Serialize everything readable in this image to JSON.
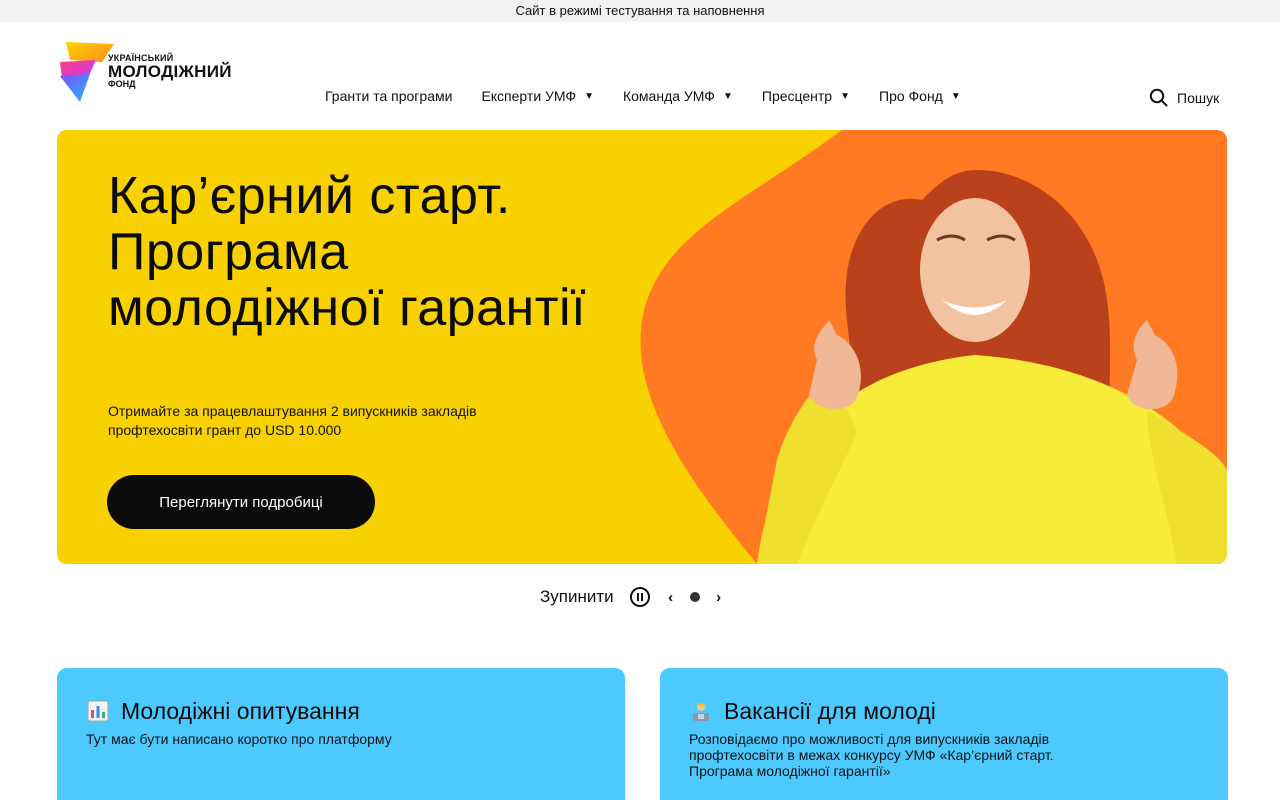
{
  "banner": {
    "text": "Сайт в режимі тестування та наповнення"
  },
  "logo": {
    "line1": "УКРАЇНСЬКИЙ",
    "line2": "МОЛОДІЖНИЙ",
    "line3": "ФОНД"
  },
  "nav": {
    "items": [
      {
        "label": "Гранти та програми",
        "dropdown": false
      },
      {
        "label": "Експерти УМФ",
        "dropdown": true
      },
      {
        "label": "Команда УМФ",
        "dropdown": true
      },
      {
        "label": "Пресцентр",
        "dropdown": true
      },
      {
        "label": "Про Фонд",
        "dropdown": true
      }
    ],
    "search_label": "Пошук"
  },
  "hero": {
    "title": "Кар’єрний старт. Програма молодіжної гарантії",
    "subtitle": "Отримайте за працевлаштування 2 випускників закладів профтехосвіти грант до USD 10.000",
    "button": "Переглянути подробиці"
  },
  "slider": {
    "pause_label": "Зупинити",
    "current": 1,
    "total": 1
  },
  "cards": [
    {
      "icon": "bar-chart-icon",
      "title": "Молодіжні опитування",
      "description": "Тут має бути написано коротко про платформу"
    },
    {
      "icon": "worker-icon",
      "title": "Вакансії для молоді",
      "description": "Розповідаємо про можливості для випускників закладів профтехосвіти в межах конкурсу УМФ «Кар’єрний старт. Програма молодіжної гарантії»"
    }
  ],
  "colors": {
    "hero_yellow": "#f9d100",
    "hero_orange": "#ff7a22",
    "card_blue": "#4ccaff",
    "button_dark": "#0b0b0b"
  }
}
